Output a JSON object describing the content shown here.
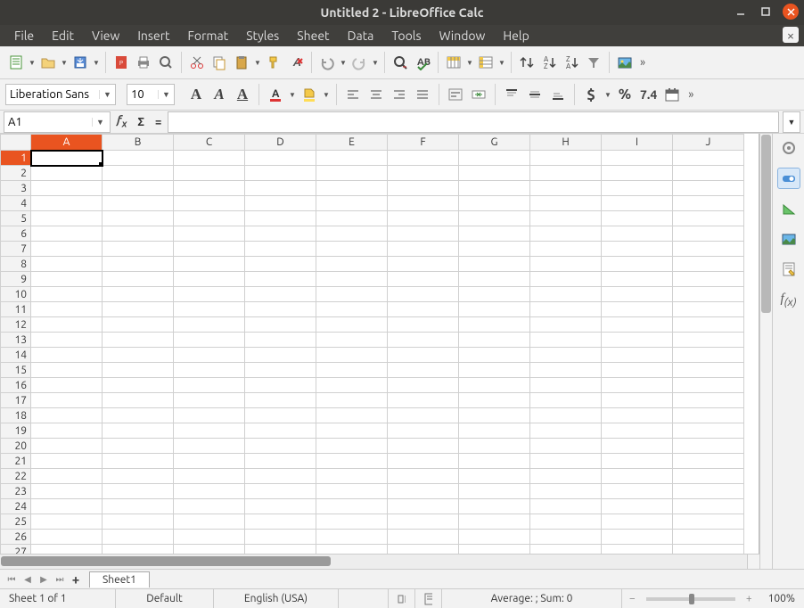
{
  "window": {
    "title": "Untitled 2 - LibreOffice Calc"
  },
  "menu": {
    "items": [
      "File",
      "Edit",
      "View",
      "Insert",
      "Format",
      "Styles",
      "Sheet",
      "Data",
      "Tools",
      "Window",
      "Help"
    ]
  },
  "format": {
    "font_name": "Liberation Sans",
    "font_size": "10"
  },
  "cellref": {
    "name": "A1",
    "formula": ""
  },
  "sheet": {
    "columns": [
      "A",
      "B",
      "C",
      "D",
      "E",
      "F",
      "G",
      "H",
      "I",
      "J"
    ],
    "row_count": 27,
    "active": {
      "col": 0,
      "row": 0
    },
    "tab": "Sheet1"
  },
  "status": {
    "sheet_info": "Sheet 1 of 1",
    "style": "Default",
    "language": "English (USA)",
    "avg_sum": "Average: ; Sum: 0",
    "zoom": "100%"
  },
  "toolbar": {
    "dollar": "$",
    "percent": "%",
    "num": "7.4"
  }
}
